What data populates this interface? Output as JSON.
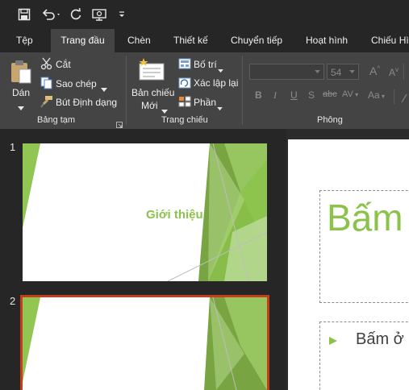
{
  "qat": {
    "save_icon": "save-icon",
    "undo_icon": "undo-icon",
    "redo_icon": "redo-icon",
    "present_icon": "present-from-start-icon",
    "customize_icon": "customize-qat-icon"
  },
  "tabs": [
    {
      "label": "Tệp"
    },
    {
      "label": "Trang đầu"
    },
    {
      "label": "Chèn"
    },
    {
      "label": "Thiết kế"
    },
    {
      "label": "Chuyển tiếp"
    },
    {
      "label": "Hoạt hình"
    },
    {
      "label": "Chiếu Hì"
    }
  ],
  "ribbon": {
    "clipboard": {
      "paste": "Dán",
      "cut": "Cắt",
      "copy": "Sao chép",
      "format_painter": "Bút Định dạng",
      "group_label": "Bảng tạm"
    },
    "slides": {
      "new_slide_line1": "Bản chiếu",
      "new_slide_line2": "Mới",
      "layout": "Bố trí",
      "reset": "Xác lập lại",
      "section": "Phần",
      "group_label": "Trang chiếu"
    },
    "font": {
      "font_name": "",
      "font_size": "54",
      "bold": "B",
      "italic": "I",
      "underline": "U",
      "strike": "S",
      "shadow": "abc",
      "spacing": "AV",
      "case": "Aa",
      "grow": "A",
      "shrink": "A",
      "group_label": "Phông"
    }
  },
  "slides": [
    {
      "number": "1",
      "title": "Giới thiệu"
    },
    {
      "number": "2",
      "title": ""
    }
  ],
  "editor": {
    "title_text": "Bấm",
    "bullet_text": "Bấm ở"
  },
  "colors": {
    "accent_green": "#8bc34a",
    "selection_border": "#c43e1c",
    "ribbon_bg": "#444444",
    "app_bg": "#262626"
  }
}
